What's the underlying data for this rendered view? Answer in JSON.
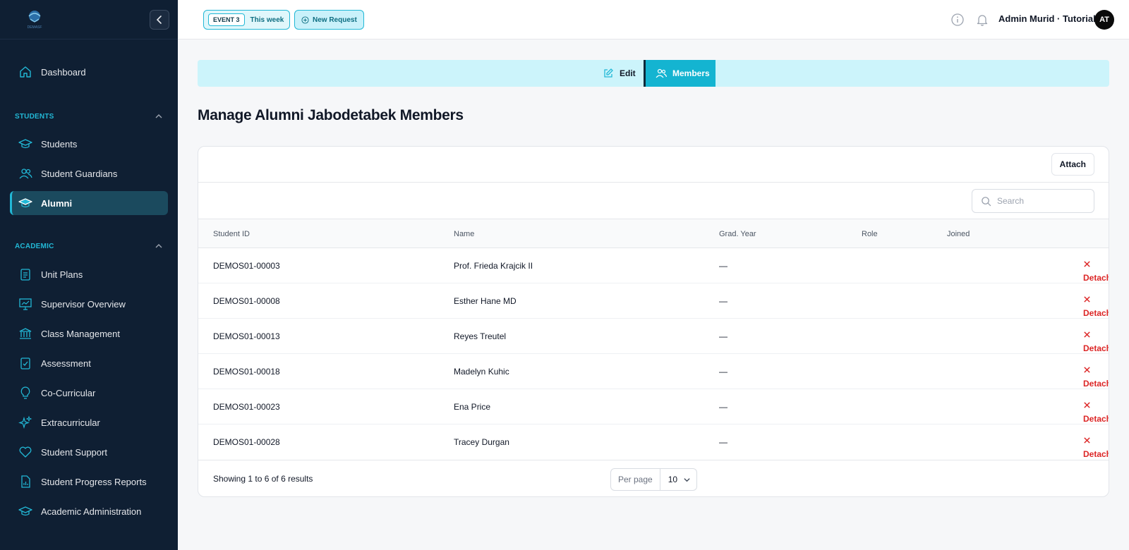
{
  "sidebar": {
    "logo_text": "DEMASF",
    "items_top": [
      {
        "label": "Dashboard",
        "icon": "home-icon"
      }
    ],
    "sections": [
      {
        "title": "STUDENTS",
        "items": [
          {
            "label": "Students",
            "icon": "graduation-cap-icon"
          },
          {
            "label": "Student Guardians",
            "icon": "users-icon"
          },
          {
            "label": "Alumni",
            "icon": "graduation-cap-icon",
            "active": true
          }
        ]
      },
      {
        "title": "ACADEMIC",
        "items": [
          {
            "label": "Unit Plans",
            "icon": "clipboard-list-icon"
          },
          {
            "label": "Supervisor Overview",
            "icon": "presentation-chart-icon"
          },
          {
            "label": "Class Management",
            "icon": "building-columns-icon"
          },
          {
            "label": "Assessment",
            "icon": "clipboard-check-icon"
          },
          {
            "label": "Co-Curricular",
            "icon": "lightbulb-icon"
          },
          {
            "label": "Extracurricular",
            "icon": "sparkles-icon"
          },
          {
            "label": "Student Support",
            "icon": "heart-icon"
          },
          {
            "label": "Student Progress Reports",
            "icon": "document-chart-icon"
          },
          {
            "label": "Academic Administration",
            "icon": "graduation-cap-icon"
          }
        ]
      }
    ]
  },
  "topbar": {
    "event_badge": "EVENT 3",
    "event_period": "This week",
    "new_request": "New Request",
    "user_name": "Admin Murid · Tutorial",
    "avatar_initials": "AT"
  },
  "tabs": {
    "edit": "Edit",
    "members": "Members"
  },
  "page_title": "Manage Alumni Jabodetabek Members",
  "table": {
    "attach_label": "Attach",
    "search_placeholder": "Search",
    "columns": [
      "Student ID",
      "Name",
      "Grad. Year",
      "Role",
      "Joined"
    ],
    "action_label": "Detach",
    "rows": [
      {
        "student_id": "DEMOS01-00003",
        "name": "Prof. Frieda Krajcik II",
        "grad_year": "—",
        "role": "",
        "joined": ""
      },
      {
        "student_id": "DEMOS01-00008",
        "name": "Esther Hane MD",
        "grad_year": "—",
        "role": "",
        "joined": ""
      },
      {
        "student_id": "DEMOS01-00013",
        "name": "Reyes Treutel",
        "grad_year": "—",
        "role": "",
        "joined": ""
      },
      {
        "student_id": "DEMOS01-00018",
        "name": "Madelyn Kuhic",
        "grad_year": "—",
        "role": "",
        "joined": ""
      },
      {
        "student_id": "DEMOS01-00023",
        "name": "Ena Price",
        "grad_year": "—",
        "role": "",
        "joined": ""
      },
      {
        "student_id": "DEMOS01-00028",
        "name": "Tracey Durgan",
        "grad_year": "—",
        "role": "",
        "joined": ""
      }
    ],
    "showing": "Showing 1 to 6 of 6 results",
    "per_page_label": "Per page",
    "per_page_value": "10"
  },
  "colors": {
    "sidebar_bg": "#0f1f33",
    "accent": "#14b4d1",
    "danger": "#dc2626"
  }
}
